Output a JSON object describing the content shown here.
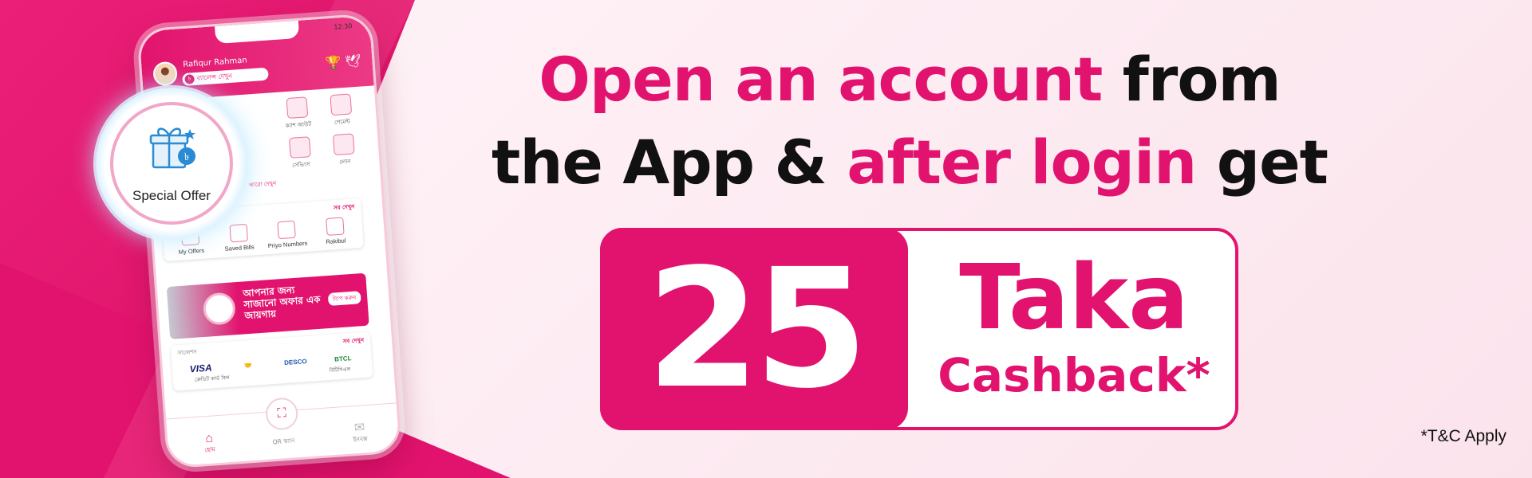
{
  "phone": {
    "status_time": "12:30",
    "user_name": "Rafiqur Rahman",
    "balance_label": "ব্যালেন্স দেখুন",
    "taka_symbol": "৳",
    "grid_items": [
      "ক্যাশ আউট",
      "পেমেন্ট",
      "সেভিংস",
      "লোন",
      "আরো দেখুন"
    ],
    "my_bkash_more": "সব দেখুন",
    "my_bkash_items": [
      "My Offers",
      "Saved Bills",
      "Priyo Numbers",
      "Rakibul"
    ],
    "promo_text": "আপনার জন্য সাজানো অফার এক জায়গায়",
    "promo_button": "ট্যাপ করুন",
    "suggestions_title": "সাজেশন",
    "suggestions_more": "সব দেখুন",
    "bill_logos": [
      "VISA",
      "",
      "DESCO",
      "BTCL"
    ],
    "bill_captions": [
      "ক্রেডিট কার্ড বিল",
      "",
      "",
      "বিটিসিএল"
    ],
    "nav": {
      "home": "হোম",
      "qr": "QR স্ক্যান",
      "inbox": "ইনবক্স"
    },
    "special_offer": "Special Offer"
  },
  "headline": {
    "l1a": "Open an account",
    "l1b": " from",
    "l2a": "the App & ",
    "l2b": "after login",
    "l2c": " get"
  },
  "badge": {
    "amount": "25",
    "currency": "Taka",
    "kind": "Cashback*"
  },
  "tnc": "*T&C Apply",
  "colors": {
    "brand": "#e2136e",
    "text": "#111111"
  }
}
